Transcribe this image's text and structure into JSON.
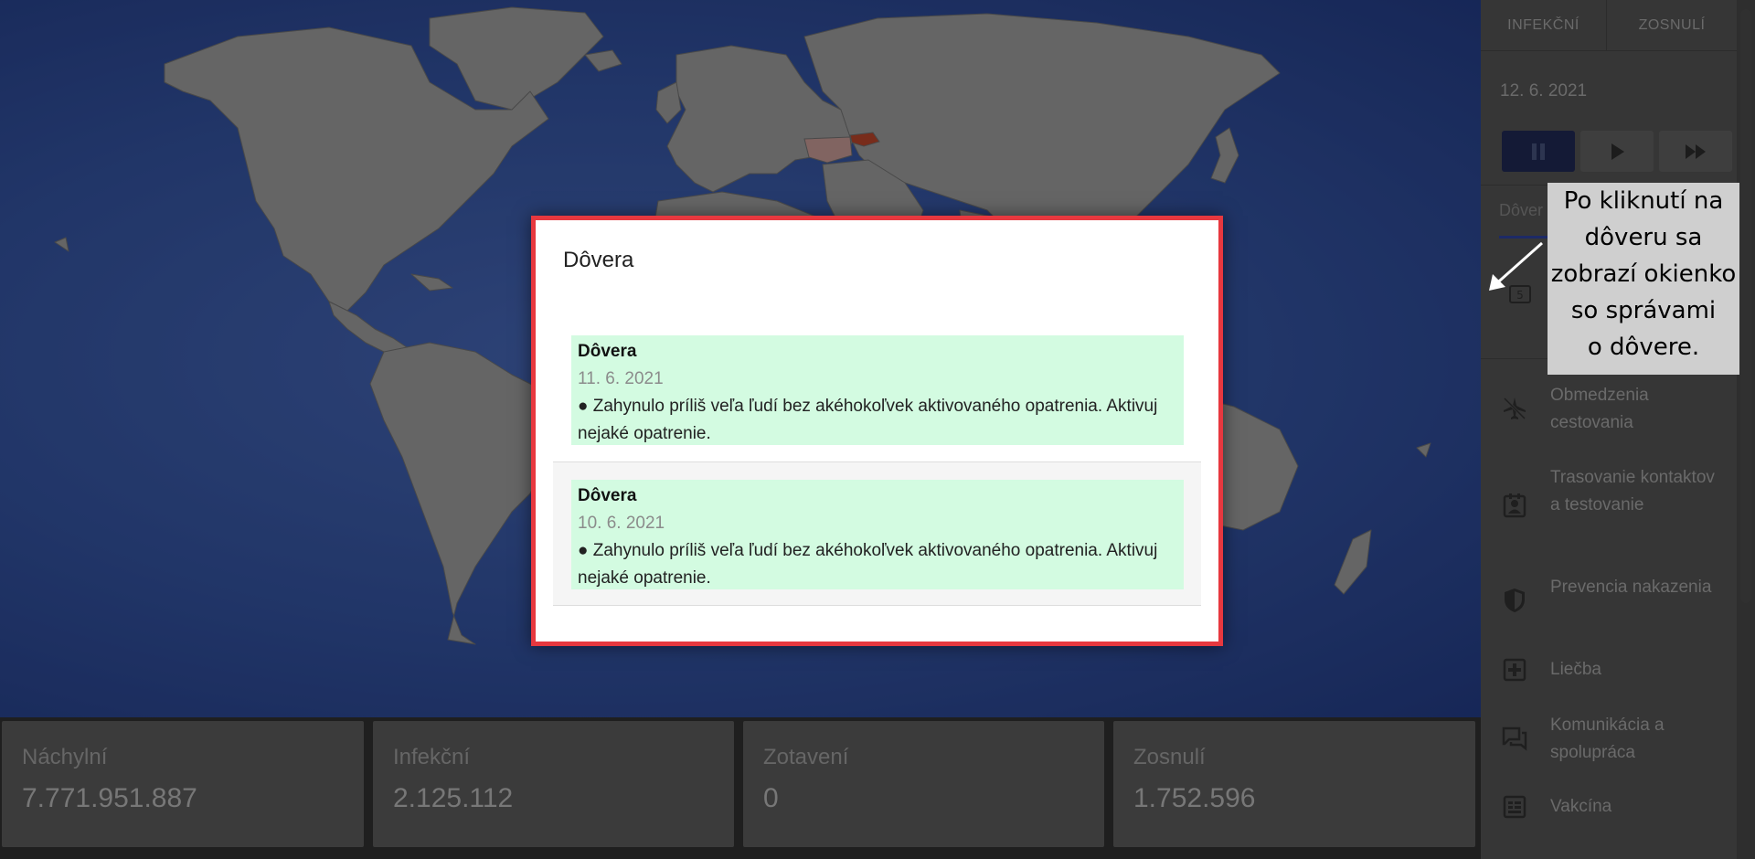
{
  "map": {
    "colors": {
      "ocean": "#33529f",
      "land": "#9b9b9b",
      "border": "#707070",
      "highlight": "#b9442a"
    }
  },
  "stats": [
    {
      "label": "Náchylní",
      "value": "7.771.951.887"
    },
    {
      "label": "Infekční",
      "value": "2.125.112"
    },
    {
      "label": "Zotavení",
      "value": "0"
    },
    {
      "label": "Zosnulí",
      "value": "1.752.596"
    }
  ],
  "sidebar": {
    "tabs": [
      "INFEKČNÍ",
      "ZOSNULÍ"
    ],
    "date": "12. 6. 2021",
    "section": "Dôver",
    "items": [
      {
        "label": "Obmedzenia cestovania",
        "icon": "airplane-off-icon"
      },
      {
        "label": "Trasovanie kontaktov a testovanie",
        "icon": "contact-card-icon"
      },
      {
        "label": "Prevencia nakazenia",
        "icon": "shield-icon"
      },
      {
        "label": "Liečba",
        "icon": "medical-plus-icon"
      },
      {
        "label": "Komunikácia a spolupráca",
        "icon": "chat-icon"
      },
      {
        "label": "Vakcína",
        "icon": "vaccine-icon"
      }
    ]
  },
  "callout": {
    "lines": [
      "Po kliknutí na",
      "dôveru sa",
      "zobrazí okienko",
      "so správami",
      "o dôvere."
    ]
  },
  "modal": {
    "title": "Dôvera",
    "messages": [
      {
        "title": "Dôvera",
        "date": "11. 6. 2021",
        "text": "● Zahynulo príliš veľa ľudí bez akéhokoľvek aktivovaného opatrenia. Aktivuj nejaké opatrenie."
      },
      {
        "title": "Dôvera",
        "date": "10. 6. 2021",
        "text": "● Zahynulo príliš veľa ľudí bez akéhokoľvek aktivovaného opatrenia. Aktivuj nejaké opatrenie."
      }
    ]
  }
}
